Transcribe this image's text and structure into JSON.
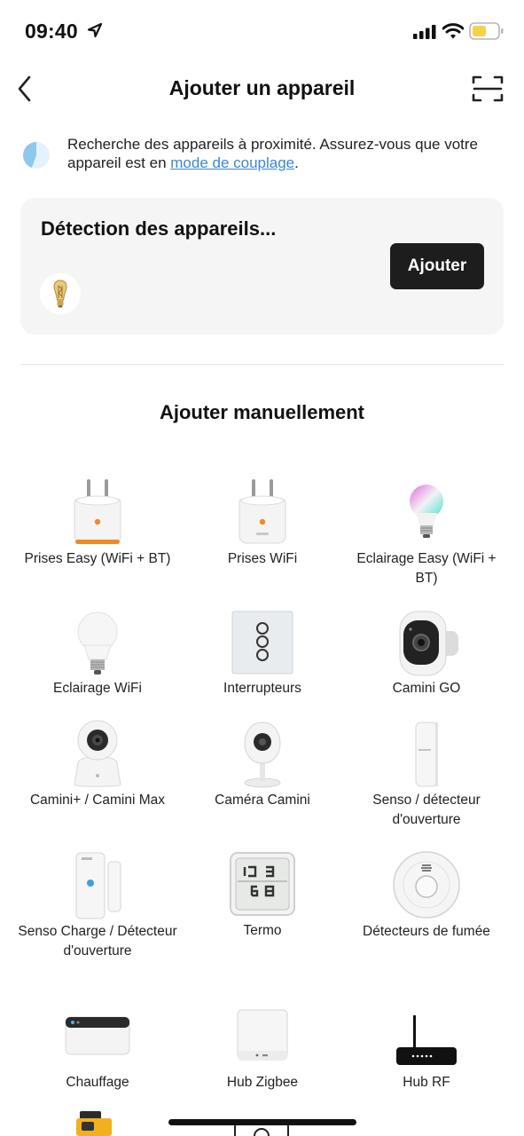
{
  "status_bar": {
    "time": "09:40",
    "battery_color": "#f5d24b"
  },
  "nav": {
    "title": "Ajouter un appareil",
    "back_icon": "chevron-left-icon",
    "scan_icon": "scan-icon"
  },
  "notice": {
    "text_before": "Recherche des appareils à proximité. Assurez-vous que votre appareil est en ",
    "link": "mode de couplage",
    "text_after": "."
  },
  "detection": {
    "title": "Détection des appareils...",
    "add_button": "Ajouter"
  },
  "manual": {
    "title": "Ajouter manuellement",
    "devices": [
      {
        "label": "Prises Easy (WiFi + BT)",
        "icon": "smart-plug-orange-icon"
      },
      {
        "label": "Prises WiFi",
        "icon": "smart-plug-icon"
      },
      {
        "label": "Eclairage Easy (WiFi + BT)",
        "icon": "rgb-bulb-icon"
      },
      {
        "label": "Eclairage WiFi",
        "icon": "bulb-icon"
      },
      {
        "label": "Interrupteurs",
        "icon": "wall-switch-icon"
      },
      {
        "label": "Camini GO",
        "icon": "outdoor-camera-icon"
      },
      {
        "label": "Camini+ / Camini Max",
        "icon": "pan-camera-icon"
      },
      {
        "label": "Caméra Camini",
        "icon": "dome-camera-icon"
      },
      {
        "label": "Senso / détecteur d'ouverture",
        "icon": "door-sensor-icon"
      },
      {
        "label": "Senso Charge / Détecteur d'ouverture",
        "icon": "door-sensor-charge-icon"
      },
      {
        "label": "Termo",
        "icon": "thermometer-display-icon"
      },
      {
        "label": "Détecteurs de fumée",
        "icon": "smoke-detector-icon"
      },
      {
        "label": "Chauffage",
        "icon": "heating-controller-icon"
      },
      {
        "label": "Hub Zigbee",
        "icon": "zigbee-hub-icon"
      },
      {
        "label": "Hub RF",
        "icon": "rf-hub-icon"
      }
    ]
  },
  "colors": {
    "accent_link": "#3a86d4",
    "button_bg": "#1d1d1d",
    "card_bg": "#f5f5f6"
  }
}
